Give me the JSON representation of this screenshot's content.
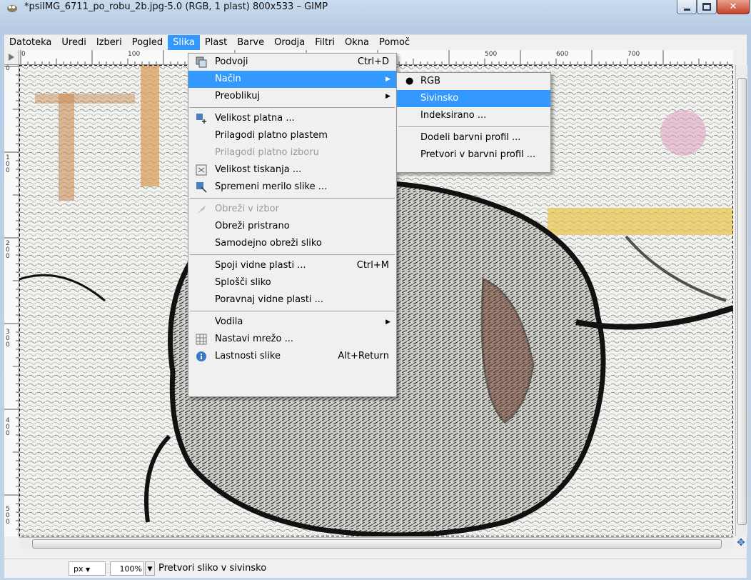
{
  "window": {
    "title": "*psiIMG_6711_po_robu_2b.jpg-5.0 (RGB, 1 plast) 800x533 – GIMP",
    "minimize_icon": "minimize-icon",
    "maximize_icon": "maximize-icon",
    "close_icon": "close-icon"
  },
  "menubar": [
    "Datoteka",
    "Uredi",
    "Izberi",
    "Pogled",
    "Slika",
    "Plast",
    "Barve",
    "Orodja",
    "Filtri",
    "Okna",
    "Pomoč"
  ],
  "rulers": {
    "h_labels": [
      "0",
      "100",
      "500",
      "600",
      "700"
    ],
    "v_labels": [
      "0",
      "100",
      "200",
      "300",
      "400",
      "500"
    ]
  },
  "slika_menu": {
    "items": [
      {
        "label": "Podvoji",
        "accel": "Ctrl+D",
        "icon": "duplicate-icon"
      },
      {
        "label": "Način",
        "submenu": true
      },
      {
        "label": "Preoblikuj",
        "submenu": true
      },
      {
        "label": "Velikost platna ...",
        "icon": "canvas-size-icon"
      },
      {
        "label": "Prilagodi platno plastem"
      },
      {
        "label": "Prilagodi platno izboru",
        "disabled": true
      },
      {
        "label": "Velikost tiskanja ...",
        "icon": "print-size-icon"
      },
      {
        "label": "Spremeni merilo slike ...",
        "icon": "scale-image-icon"
      },
      {
        "label": "Obreži v izbor",
        "disabled": true,
        "icon": "crop-icon"
      },
      {
        "label": "Obreži pristrano"
      },
      {
        "label": "Samodejno obreži sliko"
      },
      {
        "label": "Spoji vidne plasti ...",
        "accel": "Ctrl+M"
      },
      {
        "label": "Splošči sliko"
      },
      {
        "label": "Poravnaj vidne plasti ..."
      },
      {
        "label": "Vodila",
        "submenu": true
      },
      {
        "label": "Nastavi mrežo ...",
        "icon": "grid-icon"
      },
      {
        "label": "Lastnosti slike",
        "accel": "Alt+Return",
        "icon": "info-icon"
      }
    ]
  },
  "nacin_menu": {
    "items": [
      {
        "label": "RGB",
        "checked": true
      },
      {
        "label": "Sivinsko"
      },
      {
        "label": "Indeksirano ..."
      },
      {
        "label": "Dodeli barvni profil ..."
      },
      {
        "label": "Pretvori v barvni profil ..."
      }
    ]
  },
  "statusbar": {
    "unit": "px",
    "zoom": "100%",
    "message": "Pretvori sliko v sivinsko"
  },
  "colors": {
    "highlight": "#3399ff",
    "menu_bg": "#f0f0f0"
  }
}
